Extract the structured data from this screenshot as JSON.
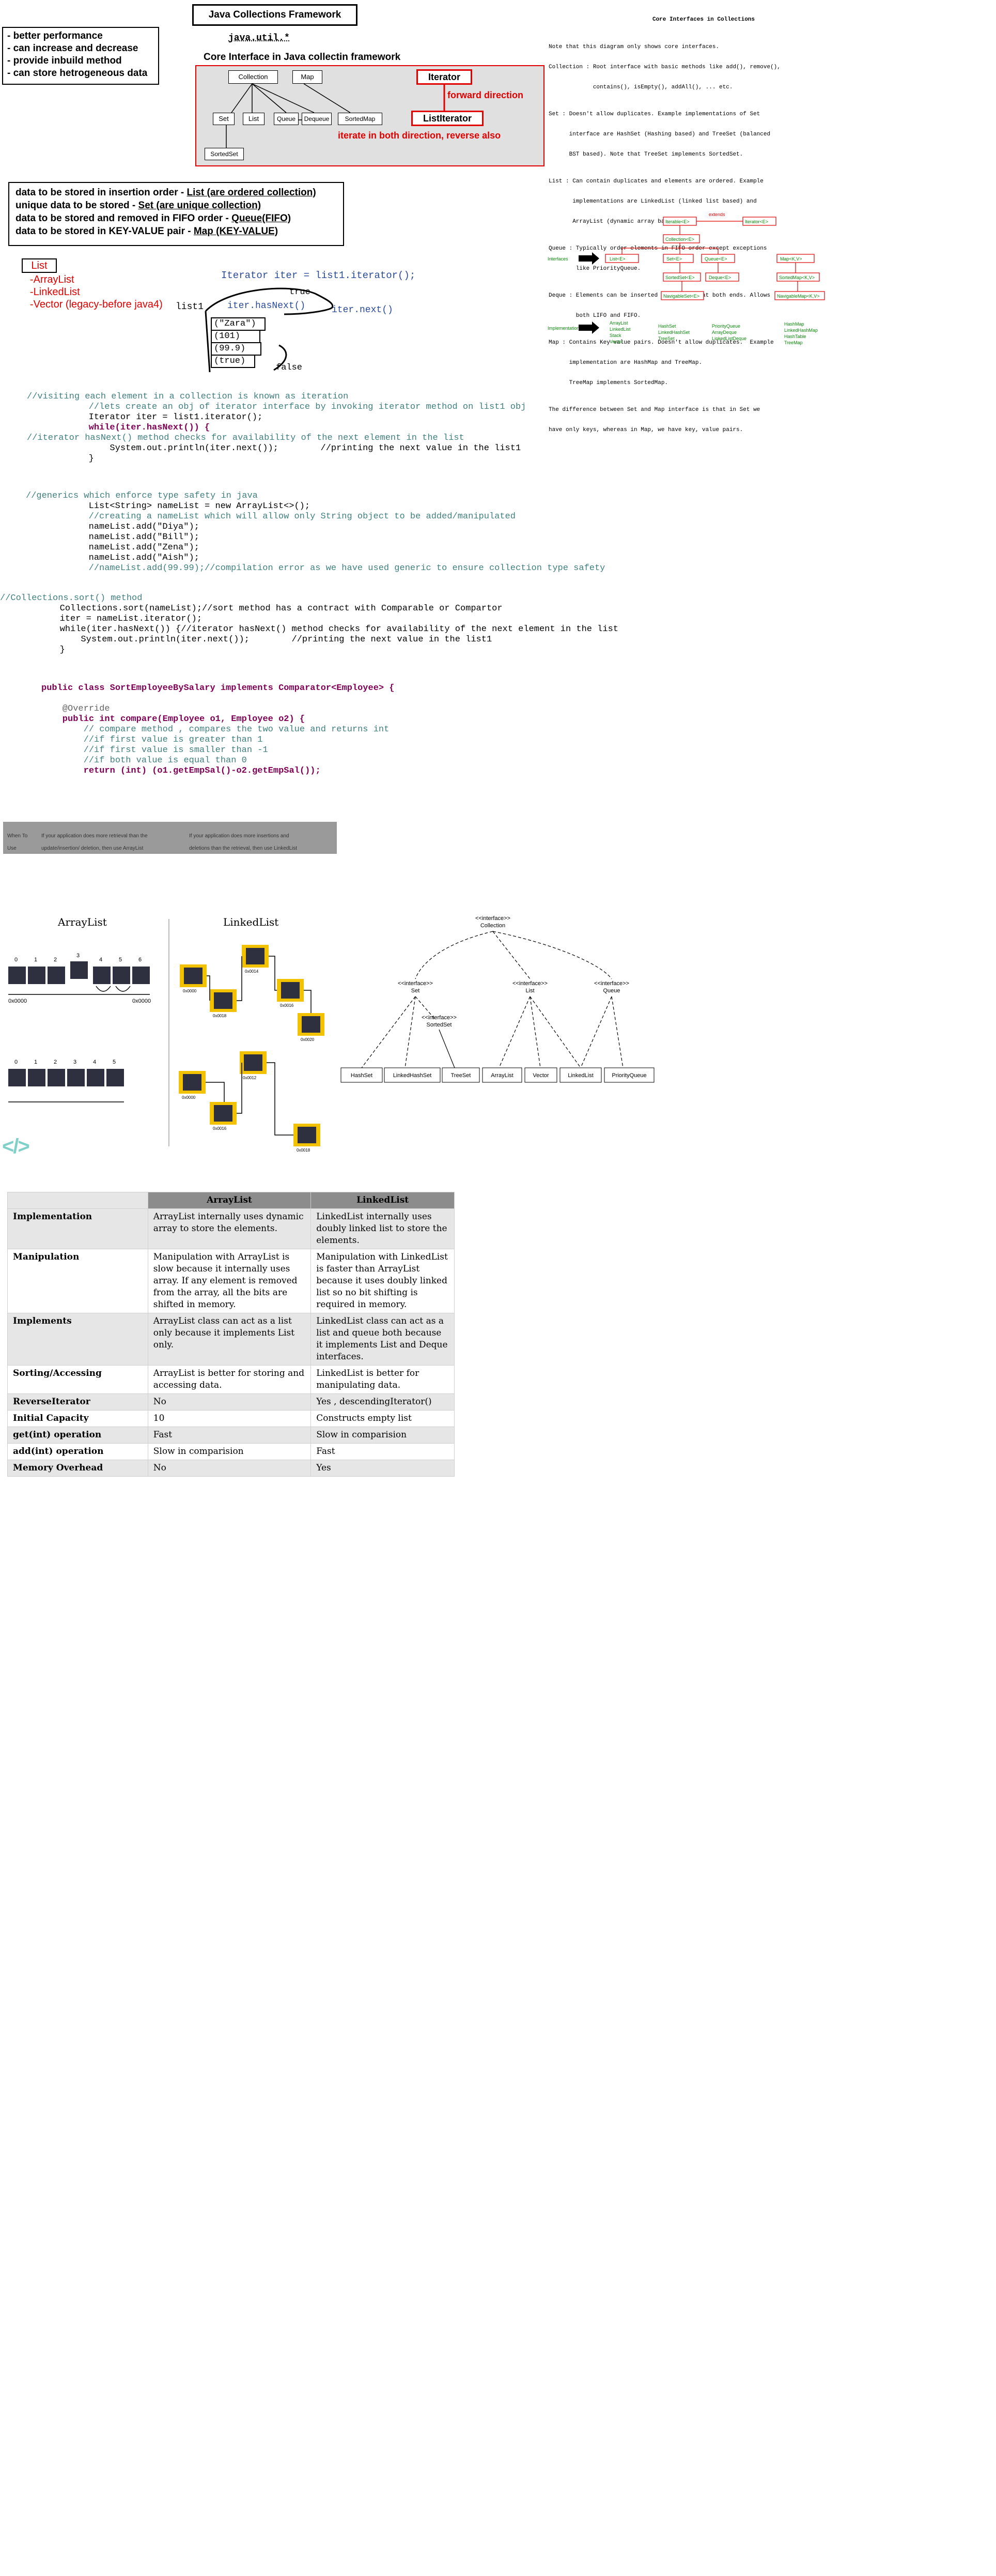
{
  "features_box": {
    "lines": [
      "- better performance",
      "- can increase and decrease",
      "- provide inbuild method",
      "- can store hetrogeneous data"
    ]
  },
  "framework_title": "Java Collections Framework",
  "package_label": "java.util.*",
  "core_interface_title": "Core Interface in Java collectin framework",
  "hierarchy": {
    "collection": "Collection",
    "map": "Map",
    "set": "Set",
    "list": "List",
    "queue": "Queue",
    "dequeue": "Dequeue",
    "sortedmap": "SortedMap",
    "sortedset": "SortedSet",
    "iterator": "Iterator",
    "forward_note": "forward direction",
    "listiterator": "ListIterator",
    "both_note": "iterate in both direction, reverse also"
  },
  "storage_box": {
    "l1": "data to be stored in insertion order - ",
    "l1_em": "List (are ordered collection)",
    "l2": "unique data to be stored  - ",
    "l2_em": "Set (are unique collection)",
    "l3": "data to be stored and removed in FIFO order - ",
    "l3_em": "Queue(FIFO)",
    "l4": "data to be stored in KEY-VALUE pair - ",
    "l4_em": "Map (KEY-VALUE)"
  },
  "list_types": {
    "title": "List",
    "items": [
      "-ArrayList",
      "-LinkedList",
      "-Vector (legacy-before java4)"
    ]
  },
  "iterator_diagram": {
    "code": "Iterator iter = list1.iterator();",
    "list_label": "list1",
    "true_label": "true",
    "hasnext_label": "iter.hasNext()",
    "next_label": "iter.next()",
    "items": [
      "(\"Zara\")",
      "(101)",
      "(99.9)",
      "(true)"
    ],
    "false_label": "false"
  },
  "code_block_1": [
    "//visiting each element in a collection is known as iteration",
    "        //lets create an obj of iterator interface by invoking iterator method on list1 obj",
    "        Iterator iter = list1.iterator();",
    "        while(iter.hasNext()) {",
    "//iterator hasNext() method checks for availability of the next element in the list",
    "            System.out.println(iter.next());        //printing the next value in the list1",
    "        }"
  ],
  "code_block_2": [
    "//generics which enforce type safety in java",
    "        List<String> nameList = new ArrayList<>();",
    "        //creating a nameList which will allow only String object to be added/manipulated",
    "        nameList.add(\"Diya\");",
    "        nameList.add(\"Bill\");",
    "        nameList.add(\"Zena\");",
    "        nameList.add(\"Aish\");",
    "        //nameList.add(99.99);//compilation error as we have used generic to ensure collection type safety"
  ],
  "code_block_3": [
    "//Collections.sort() method",
    "        Collections.sort(nameList);//sort method has a contract with Comparable or Compartor",
    "        iter = nameList.iterator();",
    "        while(iter.hasNext()) {//iterator hasNext() method checks for availability of the next element in the list",
    "            System.out.println(iter.next());        //printing the next value in the list1",
    "        }"
  ],
  "code_block_4": [
    "public class SortEmployeeBySalary implements Comparator<Employee> {",
    "",
    "    @Override",
    "    public int compare(Employee o1, Employee o2) {",
    "        // compare method , compares the two value and returns int",
    "        //if first value is greater than 1",
    "        //if first value is smaller than -1",
    "        //if both value is equal than 0",
    "        return (int) (o1.getEmpSal()-o2.getEmpSal());"
  ],
  "gray_strip": {
    "c1": "When To",
    "c2": "If your application does more retrieval than the",
    "c3": "If your application does more insertions and",
    "c4": "Use",
    "c5": "update/insertion/ deletion, then use ArrayList",
    "c6": "deletions than the retrieval, then use LinkedList"
  },
  "right_panel": {
    "title": "Core Interfaces in Collections",
    "intro1": "Note that this diagram only shows core interfaces.",
    "intro2": "Collection : Root interface with basic methods like add(), remove(),",
    "intro3": "             contains(), isEmpty(), addAll(), ... etc.",
    "set1": "Set : Doesn't allow duplicates. Example implementations of Set",
    "set2": "      interface are HashSet (Hashing based) and TreeSet (balanced",
    "set3": "      BST based). Note that TreeSet implements SortedSet.",
    "list1": "List : Can contain duplicates and elements are ordered. Example",
    "list2": "       implementations are LinkedList (linked list based) and",
    "list3": "       ArrayList (dynamic array based)",
    "queue1": "Queue : Typically order elements in FIFO order except exceptions",
    "queue2": "        like PriorityQueue.",
    "deque1": "Deque : Elements can be inserted and removed at both ends. Allows",
    "deque2": "        both LIFO and FIFO.",
    "map1": "Map : Contains Key value pairs. Doesn't allow duplicates.  Example",
    "map2": "      implementation are HashMap and TreeMap.",
    "map3": "      TreeMap implements SortedMap.",
    "diff1": "The difference between Set and Map interface is that in Set we",
    "diff2": "have only keys, whereas in Map, we have key, value pairs."
  },
  "mini_diagram": {
    "iterable": "Iterable<E>",
    "iterator": "Iterator<E>",
    "extends_label": "extends",
    "collection": "Collection<E>",
    "interfaces_label": "Interfaces",
    "list": "List<E>",
    "set": "Set<E>",
    "queue": "Queue<E>",
    "map": "Map<K,V>",
    "sortedset": "SortedSet<E>",
    "deque": "Deque<E>",
    "sortedmap": "SortedMap<K,V>",
    "navset": "NavigableSet<E>",
    "navmap": "NavigableMap<K,V>",
    "impl_label": "Implementation\nClasses",
    "impl_list": [
      "ArrayList",
      "LinkedList",
      "Stack",
      "Vector"
    ],
    "impl_set": [
      "HashSet",
      "LinkedHashSet",
      "TreeSet"
    ],
    "impl_queue": [
      "PriorityQueue",
      "ArrayDeque",
      "LinkedListDeque"
    ],
    "impl_map": [
      "HashMap",
      "LinkedHashMap",
      "HashTable",
      "TreeMap"
    ]
  },
  "arraylist_section": {
    "title": "ArrayList",
    "idx_top": [
      "0",
      "1",
      "2",
      "3",
      "4",
      "5",
      "6"
    ],
    "idx_bottom": [
      "0",
      "1",
      "2",
      "3",
      "4",
      "5"
    ],
    "addr_a": "0x0000",
    "addr_b": "0x0000",
    "addr_c": "0x0000",
    "addr_d": "0x0000"
  },
  "linkedlist_section": {
    "title": "LinkedList",
    "addrs": [
      "0x0000",
      "0x0018",
      "0x0014",
      "0x0016",
      "0x0020",
      "0x0000",
      "0x0012",
      "0x0016",
      "0x0018"
    ]
  },
  "hier2": {
    "collection": "Collection",
    "set": "Set",
    "list": "List",
    "queue": "Queue",
    "sortedset": "SortedSet",
    "interface_tag": "<<interface>>",
    "leaves": [
      "HashSet",
      "LinkedHashSet",
      "TreeSet",
      "ArrayList",
      "Vector",
      "LinkedList",
      "PriorityQueue"
    ]
  },
  "logo_glyph": "</>",
  "comparison": {
    "head": [
      "",
      "ArrayList",
      "LinkedList"
    ],
    "rows": [
      [
        "Implementation",
        "ArrayList internally uses dynamic array to store the elements.",
        "LinkedList internally uses doubly linked list to store the elements."
      ],
      [
        "Manipulation",
        "Manipulation with ArrayList is slow because it internally uses array. If any element is removed from the array, all the bits are shifted in memory.",
        "Manipulation with LinkedList is faster than ArrayList because it uses doubly linked list so no bit shifting is required in memory."
      ],
      [
        "Implements",
        "ArrayList class can act as a list only because it implements List only.",
        "LinkedList class can act as a list and queue both because it implements List and Deque interfaces."
      ],
      [
        "Sorting/Accessing",
        "ArrayList is better for storing and accessing data.",
        "LinkedList is better for manipulating data."
      ],
      [
        "ReverseIterator",
        "No",
        "Yes , descendingIterator()"
      ],
      [
        "Initial Capacity",
        "10",
        "Constructs empty list"
      ],
      [
        "get(int) operation",
        "Fast",
        "Slow in comparision"
      ],
      [
        "add(int) operation",
        "Slow in comparision",
        "Fast"
      ],
      [
        "Memory Overhead",
        "No",
        "Yes"
      ]
    ]
  }
}
